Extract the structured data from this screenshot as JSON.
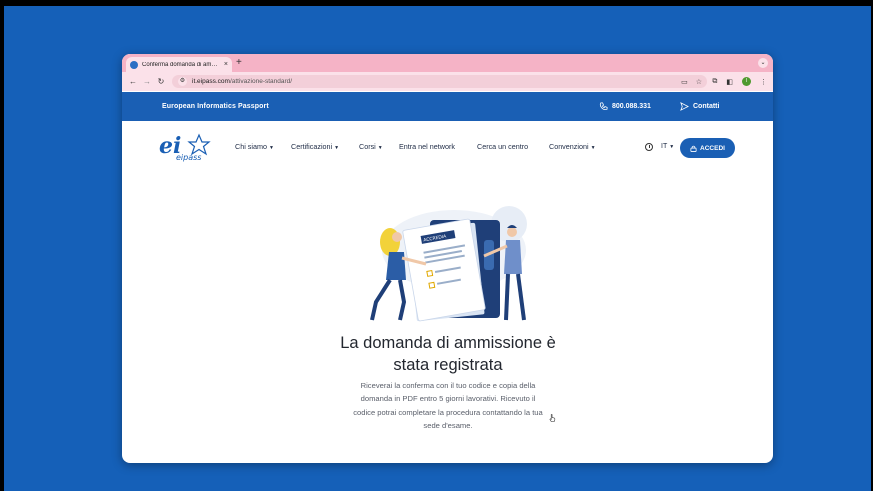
{
  "browser": {
    "tab_title": "Conferma domanda di ammis",
    "tab_close": "×",
    "new_tab": "+",
    "url_host": "it.eipass.com",
    "url_path": "/attivazione-standard/",
    "profile_initial": "I",
    "icons": [
      "back-icon",
      "forward-icon",
      "reload-icon",
      "site-info-icon",
      "cast-icon",
      "star-icon",
      "extensions-icon",
      "sidepanel-icon",
      "menu-icon"
    ]
  },
  "topbar": {
    "brand": "European Informatics Passport",
    "phone": "800.088.331",
    "contact": "Contatti"
  },
  "nav": {
    "items": [
      {
        "label": "Chi siamo",
        "dropdown": true
      },
      {
        "label": "Certificazioni",
        "dropdown": true
      },
      {
        "label": "Corsi",
        "dropdown": true
      },
      {
        "label": "Entra nel network",
        "dropdown": false
      },
      {
        "label": "Cerca un centro",
        "dropdown": false
      },
      {
        "label": "Convenzioni",
        "dropdown": true
      }
    ],
    "lang": "IT",
    "login": "ACCEDI"
  },
  "logo": {
    "text": "eipass"
  },
  "main": {
    "illustration_badge": "ACCREDIA",
    "headline_line1": "La domanda di ammissione è",
    "headline_line2": "stata registrata",
    "desc_line1": "Riceverai la conferma con il tuo codice e copia della",
    "desc_line2": "domanda in PDF entro 5 giorni lavorativi. Ricevuto il",
    "desc_line3": "codice potrai completare la procedura contattando la tua",
    "desc_line4": "sede d'esame."
  },
  "colors": {
    "desktop": "#1560b8",
    "brand_blue": "#1a5fb4",
    "tabstrip": "#f5b3c6",
    "toolbar": "#fbe1e9"
  }
}
